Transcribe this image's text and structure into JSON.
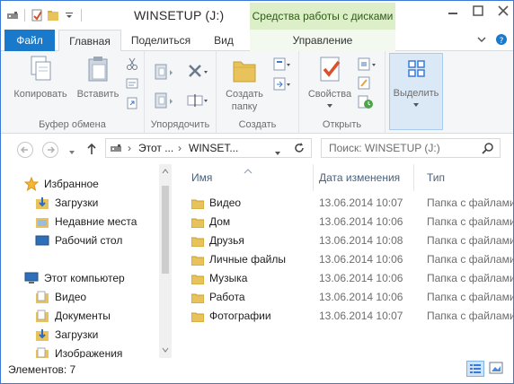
{
  "window": {
    "title": "WINSETUP (J:)"
  },
  "contextual_tab": {
    "header": "Средства работы с дисками",
    "tab_label": "Управление"
  },
  "tabs": {
    "file": "Файл",
    "home": "Главная",
    "share": "Поделиться",
    "view": "Вид"
  },
  "ribbon": {
    "clipboard": {
      "label": "Буфер обмена",
      "copy": "Копировать",
      "paste": "Вставить"
    },
    "organize": {
      "label": "Упорядочить"
    },
    "create": {
      "label": "Создать",
      "new_folder_line1": "Создать",
      "new_folder_line2": "папку"
    },
    "open": {
      "label": "Открыть",
      "properties": "Свойства"
    },
    "select": {
      "label": "Выделить"
    }
  },
  "address": {
    "seg1": "Этот ...",
    "seg2": "WINSET...",
    "separator": "›",
    "search_placeholder": "Поиск: WINSETUP (J:)"
  },
  "nav": {
    "favorites": "Избранное",
    "downloads": "Загрузки",
    "recent": "Недавние места",
    "desktop": "Рабочий стол",
    "this_pc": "Этот компьютер",
    "videos": "Видео",
    "documents": "Документы",
    "downloads2": "Загрузки",
    "pictures": "Изображения"
  },
  "columns": {
    "name": "Имя",
    "date": "Дата изменения",
    "type": "Тип"
  },
  "files": [
    {
      "name": "Видео",
      "date": "13.06.2014 10:07",
      "type": "Папка с файлами"
    },
    {
      "name": "Дом",
      "date": "13.06.2014 10:06",
      "type": "Папка с файлами"
    },
    {
      "name": "Друзья",
      "date": "13.06.2014 10:08",
      "type": "Папка с файлами"
    },
    {
      "name": "Личные файлы",
      "date": "13.06.2014 10:06",
      "type": "Папка с файлами"
    },
    {
      "name": "Музыка",
      "date": "13.06.2014 10:06",
      "type": "Папка с файлами"
    },
    {
      "name": "Работа",
      "date": "13.06.2014 10:06",
      "type": "Папка с файлами"
    },
    {
      "name": "Фотографии",
      "date": "13.06.2014 10:07",
      "type": "Папка с файлами"
    }
  ],
  "status": {
    "items_count": "Элементов: 7"
  },
  "colors": {
    "accent": "#1979ca",
    "context_green": "#dcefc9",
    "folder": "#e8c25a"
  }
}
